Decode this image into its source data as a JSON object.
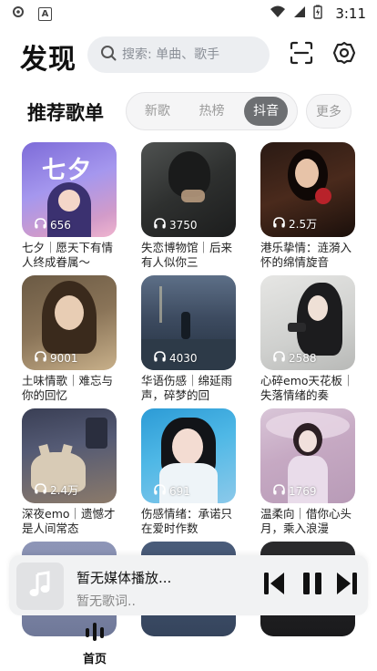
{
  "status_bar": {
    "time": "3:11",
    "notif_letter": "A"
  },
  "header": {
    "title": "发现",
    "search_placeholder": "搜索: 单曲、歌手"
  },
  "section": {
    "title": "推荐歌单",
    "tabs": [
      "新歌",
      "热榜",
      "抖音"
    ],
    "active_tab": "抖音",
    "more_label": "更多"
  },
  "playlists": [
    {
      "count": "656",
      "title": "七夕｜愿天下有情人终成眷属～",
      "cover_text": "七夕"
    },
    {
      "count": "3750",
      "title": "失恋博物馆｜后来有人似你三",
      "cover_text": ""
    },
    {
      "count": "2.5万",
      "title": "港乐挚情：涟漪入怀的绵情旋音",
      "cover_text": ""
    },
    {
      "count": "9001",
      "title": "土味情歌｜难忘与你的回忆",
      "cover_text": ""
    },
    {
      "count": "4030",
      "title": "华语伤感｜绵延雨声，碎梦的回",
      "cover_text": ""
    },
    {
      "count": "2588",
      "title": "心碎emo天花板｜失落情绪的奏",
      "cover_text": ""
    },
    {
      "count": "2.4万",
      "title": "深夜emo｜遗憾才是人间常态",
      "cover_text": ""
    },
    {
      "count": "691",
      "title": "伤感情绪：承诺只在爱时作数",
      "cover_text": ""
    },
    {
      "count": "1769",
      "title": "温柔向｜借你心头月，乘入浪漫",
      "cover_text": ""
    }
  ],
  "player": {
    "title": "暂无媒体播放...",
    "subtitle": "暂无歌词.."
  },
  "bottom_nav": {
    "home_label": "首页"
  },
  "colors": {
    "accent_tab": "#6d6f72",
    "search_bg": "#eceef1",
    "player_bg": "#f1f2f3"
  }
}
